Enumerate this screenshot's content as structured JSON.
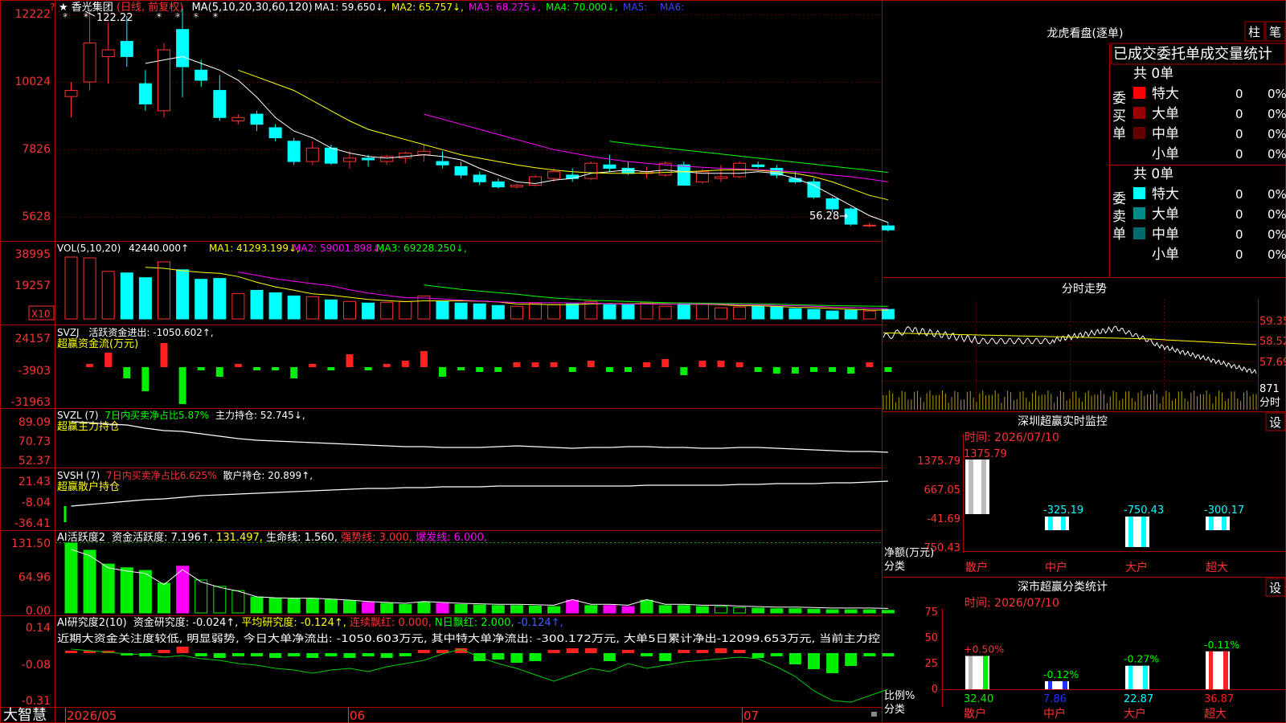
{
  "app": {
    "name": "大智慧"
  },
  "stock": {
    "star": "★",
    "name": "香光集团",
    "period": "(日线, 前复权)"
  },
  "main": {
    "ma_label": "MA(5,10,20,30,60,120)",
    "ma": [
      {
        "name": "MA1",
        "value": "59.650",
        "arrow": "↓",
        "color": "#ffffff"
      },
      {
        "name": "MA2",
        "value": "65.757",
        "arrow": "↓",
        "color": "#ffff00"
      },
      {
        "name": "MA3",
        "value": "68.275",
        "arrow": "↓",
        "color": "#ff00ff"
      },
      {
        "name": "MA4",
        "value": "70.000",
        "arrow": "↓",
        "color": "#00ff00"
      },
      {
        "name": "MA5",
        "value": "",
        "arrow": "",
        "color": "#4040ff"
      },
      {
        "name": "MA6",
        "value": "",
        "arrow": "",
        "color": "#4040ff"
      }
    ],
    "y_ticks": [
      "12222",
      "10024",
      "7826",
      "5628"
    ],
    "high_label": "122.22",
    "low_label": "56.28→",
    "question": "?"
  },
  "vol": {
    "label": "VOL(5,10,20)",
    "value": "42440.000↑",
    "ma": [
      {
        "name": "MA1",
        "value": "41293.199↓",
        "color": "#ffff00"
      },
      {
        "name": "MA2",
        "value": "59001.898↓",
        "color": "#ff00ff"
      },
      {
        "name": "MA3",
        "value": "69228.250↓",
        "color": "#00ff00"
      }
    ],
    "y_ticks": [
      "38995",
      "19257"
    ],
    "unit": "X10"
  },
  "svzj": {
    "label": "SVZJ",
    "desc": "活跃资金进出: -1050.602↑,",
    "sub": "超赢资金流(万元)",
    "y_ticks": [
      "24157",
      "-3903",
      "-31963"
    ]
  },
  "svzl": {
    "label": "SVZL (7)",
    "desc": "7日内买卖净占比5.87%",
    "desc2": "主力持仓: 52.745↓,",
    "sub": "超赢主力持仓",
    "y_ticks": [
      "89.09",
      "70.73",
      "52.37"
    ]
  },
  "svsh": {
    "label": "SVSH (7)",
    "desc": "7日内买卖净占比6.625%",
    "desc2": "散户持仓: 20.899↑,",
    "sub": "超赢散户持仓",
    "y_ticks": [
      "21.43",
      "-8.04",
      "-36.41"
    ]
  },
  "ai1": {
    "label": "AI活跃度2",
    "items": [
      {
        "t": "资金活跃度: 7.196↑,",
        "c": "#ffffff"
      },
      {
        "t": "131.497,",
        "c": "#ffff00"
      },
      {
        "t": "生命线: 1.560,",
        "c": "#ffffff"
      },
      {
        "t": "强势线: 3.000,",
        "c": "#ff3333"
      },
      {
        "t": "爆发线: 6.000,",
        "c": "#ff00ff"
      }
    ],
    "y_ticks": [
      "131.50",
      "64.96",
      "0.00"
    ]
  },
  "ai2": {
    "label": "AI研究度2(10)",
    "items": [
      {
        "t": "资金研究度: -0.024↑,",
        "c": "#ffffff"
      },
      {
        "t": "平均研究度: -0.124↑,",
        "c": "#ffff00"
      },
      {
        "t": "连续飘红: 0.000,",
        "c": "#ff3333"
      },
      {
        "t": "N日飘红: 2.000,",
        "c": "#00ff00"
      },
      {
        "t": "-0.124↑,",
        "c": "#4060ff"
      }
    ],
    "note": "近期大资金关注度较低, 明显弱势, 今日大单净流出: -1050.603万元, 其中特大单净流出: -300.172万元, 大单5日累计净出-12099.653万元, 当前主力控",
    "y_ticks": [
      "0.14",
      "-0.08",
      "-0.31"
    ]
  },
  "x_axis": {
    "labels": [
      "2026/05",
      "06",
      "07"
    ]
  },
  "right": {
    "lhkp": {
      "title": "龙虎看盘(逐单)",
      "btn1": "柱",
      "btn2": "笔",
      "header": "已成交委托单成交量统计",
      "buy": {
        "side": "委买单",
        "total": "共 0单",
        "rows": [
          {
            "name": "特大",
            "count": "0",
            "pct": "0%",
            "color": "#ff0000"
          },
          {
            "name": "大单",
            "count": "0",
            "pct": "0%",
            "color": "#990000"
          },
          {
            "name": "中单",
            "count": "0",
            "pct": "0%",
            "color": "#660000"
          },
          {
            "name": "小单",
            "count": "0",
            "pct": "0%",
            "color": ""
          }
        ]
      },
      "sell": {
        "side": "委卖单",
        "total": "共 0单",
        "rows": [
          {
            "name": "特大",
            "count": "0",
            "pct": "0%",
            "color": "#00ffff"
          },
          {
            "name": "大单",
            "count": "0",
            "pct": "0%",
            "color": "#008b8b"
          },
          {
            "name": "中单",
            "count": "0",
            "pct": "0%",
            "color": "#006b6b"
          },
          {
            "name": "小单",
            "count": "0",
            "pct": "0%",
            "color": ""
          }
        ]
      }
    },
    "fszs": {
      "title": "分时走势",
      "y_ticks": [
        "59.35",
        "58.52",
        "57.69"
      ],
      "vol_tick": "871",
      "vol_label": "分时"
    },
    "szcy": {
      "title": "深圳超赢实时监控",
      "btn": "设",
      "time": "时间: 2026/07/10",
      "y_ticks": [
        "1375.79",
        "667.05",
        "-41.69",
        "-750.43"
      ],
      "ylabel": "净额(万元)",
      "xlabel": "分类",
      "categories": [
        "散户",
        "中户",
        "大户",
        "超大"
      ],
      "values": [
        1375.79,
        -325.19,
        -750.43,
        -300.17
      ],
      "value_labels": [
        "1375.79",
        "-325.19",
        "-750.43",
        "-300.17"
      ]
    },
    "sscy": {
      "title": "深市超赢分类统计",
      "btn": "设",
      "time": "时间: 2026/07/10",
      "y_ticks": [
        "75",
        "50",
        "25",
        "0"
      ],
      "ylabel": "比例%",
      "xlabel": "分类",
      "categories": [
        "散户",
        "中户",
        "大户",
        "超大"
      ],
      "values": [
        32.4,
        7.86,
        22.87,
        36.87
      ],
      "changes": [
        "+0.50%",
        "-0.12%",
        "-0.27%",
        "-0.11%"
      ]
    }
  },
  "chart_data": {
    "type": "candlestick",
    "dates_axis": [
      "2026/05",
      "06",
      "07"
    ],
    "ohlc": [
      [
        96.2,
        100.5,
        90.0,
        98.0
      ],
      [
        100.5,
        122.2,
        98.0,
        112.0
      ],
      [
        108.0,
        118.0,
        100.0,
        110.0
      ],
      [
        112.5,
        120.0,
        105.0,
        108.0
      ],
      [
        100.0,
        104.0,
        92.0,
        94.0
      ],
      [
        92.0,
        112.0,
        90.0,
        110.0
      ],
      [
        116.0,
        122.2,
        96.0,
        105.0
      ],
      [
        104.0,
        107.0,
        99.0,
        101.0
      ],
      [
        98.0,
        102.5,
        89.0,
        90.0
      ],
      [
        89.0,
        91.0,
        88.0,
        90.0
      ],
      [
        91.0,
        92.0,
        86.0,
        88.0
      ],
      [
        87.0,
        88.0,
        83.0,
        84.0
      ],
      [
        83.0,
        84.0,
        76.0,
        77.0
      ],
      [
        77.0,
        83.0,
        76.0,
        81.0
      ],
      [
        81.0,
        82.0,
        76.0,
        76.5
      ],
      [
        77.0,
        80.0,
        75.0,
        78.0
      ],
      [
        78.0,
        79.0,
        75.5,
        77.5
      ],
      [
        77.0,
        79.0,
        76.0,
        78.5
      ],
      [
        78.0,
        80.0,
        76.5,
        79.5
      ],
      [
        79.0,
        82.0,
        77.0,
        80.0
      ],
      [
        77.0,
        80.0,
        75.0,
        76.0
      ],
      [
        75.5,
        77.0,
        72.0,
        73.0
      ],
      [
        73.0,
        74.0,
        70.0,
        71.0
      ],
      [
        71.0,
        72.0,
        69.0,
        69.5
      ],
      [
        69.5,
        70.5,
        69.0,
        70.0
      ],
      [
        70.0,
        73.0,
        69.5,
        72.5
      ],
      [
        72.0,
        75.0,
        71.0,
        74.0
      ],
      [
        73.0,
        75.0,
        71.0,
        72.0
      ],
      [
        72.0,
        77.0,
        71.5,
        76.5
      ],
      [
        76.0,
        79.0,
        74.0,
        75.0
      ],
      [
        75.0,
        77.0,
        73.0,
        73.5
      ],
      [
        73.5,
        75.5,
        72.0,
        74.0
      ],
      [
        73.0,
        77.0,
        72.5,
        76.5
      ],
      [
        76.0,
        77.0,
        70.0,
        70.0
      ],
      [
        71.0,
        75.0,
        70.5,
        74.0
      ],
      [
        72.0,
        76.0,
        71.0,
        72.5
      ],
      [
        72.5,
        77.0,
        72.0,
        76.5
      ],
      [
        76.0,
        77.0,
        75.0,
        75.5
      ],
      [
        75.0,
        76.0,
        72.0,
        73.0
      ],
      [
        72.0,
        74.0,
        70.5,
        71.0
      ],
      [
        71.0,
        72.0,
        66.0,
        66.5
      ],
      [
        66.0,
        66.5,
        62.0,
        63.0
      ],
      [
        63.0,
        63.5,
        58.0,
        58.5
      ],
      [
        58.0,
        59.0,
        57.5,
        58.2
      ],
      [
        58.0,
        59.0,
        56.3,
        56.8
      ]
    ],
    "ma1": [
      null,
      null,
      null,
      null,
      106.0,
      107.0,
      108.0,
      106.0,
      104.0,
      101.0,
      96.0,
      90.0,
      86.0,
      84.0,
      81.0,
      79.5,
      78.5,
      78.0,
      78.5,
      79.0,
      78.5,
      77.5,
      75.0,
      73.0,
      71.0,
      70.5,
      71.5,
      72.0,
      73.5,
      74.0,
      74.5,
      74.0,
      74.5,
      74.0,
      73.5,
      73.5,
      73.5,
      74.0,
      73.5,
      72.0,
      70.0,
      67.0,
      64.0,
      61.0,
      59.0
    ],
    "ma2": [
      null,
      null,
      null,
      null,
      null,
      null,
      null,
      null,
      null,
      104.0,
      102.0,
      100.0,
      98.0,
      95.0,
      92.0,
      89.0,
      86.5,
      85.0,
      83.5,
      82.0,
      80.5,
      79.0,
      78.0,
      77.0,
      76.0,
      75.2,
      74.5,
      74.0,
      73.7,
      73.5,
      73.5,
      73.6,
      73.8,
      74.0,
      74.2,
      74.5,
      74.6,
      74.4,
      74.0,
      73.5,
      72.5,
      71.0,
      69.0,
      67.0,
      65.7
    ],
    "ma3": [
      null,
      null,
      null,
      null,
      null,
      null,
      null,
      null,
      null,
      null,
      null,
      null,
      null,
      null,
      null,
      null,
      null,
      null,
      null,
      91.0,
      89.5,
      88.0,
      86.5,
      85.0,
      83.5,
      82.0,
      80.5,
      79.5,
      78.5,
      77.7,
      77.0,
      76.5,
      76.0,
      75.6,
      75.3,
      75.0,
      74.8,
      74.6,
      74.3,
      74.0,
      73.6,
      73.0,
      72.5,
      71.8,
      71.0
    ],
    "ma4": [
      null,
      null,
      null,
      null,
      null,
      null,
      null,
      null,
      null,
      null,
      null,
      null,
      null,
      null,
      null,
      null,
      null,
      null,
      null,
      null,
      null,
      null,
      null,
      null,
      null,
      null,
      null,
      null,
      null,
      83.0,
      82.3,
      81.6,
      81.0,
      80.4,
      79.8,
      79.2,
      78.6,
      78.0,
      77.4,
      76.8,
      76.2,
      75.6,
      75.0,
      74.4,
      73.8
    ],
    "volume": [
      38995,
      38500,
      30000,
      29000,
      26000,
      36000,
      31000,
      25000,
      25500,
      16000,
      18000,
      16500,
      14500,
      14000,
      12000,
      11000,
      10000,
      10500,
      11000,
      14500,
      11000,
      10000,
      9500,
      8500,
      8000,
      10000,
      9000,
      9500,
      11000,
      9000,
      9000,
      10500,
      8000,
      9500,
      9500,
      7000,
      7500,
      8000,
      7500,
      6500,
      6000,
      5000,
      5500,
      5000,
      6000
    ]
  }
}
